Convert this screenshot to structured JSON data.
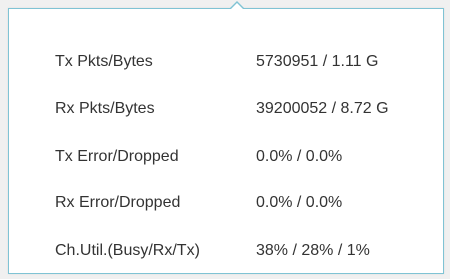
{
  "stats": {
    "rows": [
      {
        "label": "Tx Pkts/Bytes",
        "value": "5730951 / 1.11 G"
      },
      {
        "label": "Rx Pkts/Bytes",
        "value": "39200052 / 8.72 G"
      },
      {
        "label": "Tx Error/Dropped",
        "value": "0.0% / 0.0%"
      },
      {
        "label": "Rx Error/Dropped",
        "value": "0.0% / 0.0%"
      },
      {
        "label": "Ch.Util.(Busy/Rx/Tx)",
        "value": "38% / 28% / 1%"
      }
    ]
  },
  "colors": {
    "border": "#7fc3d4",
    "text": "#333333",
    "background": "#ffffff"
  }
}
